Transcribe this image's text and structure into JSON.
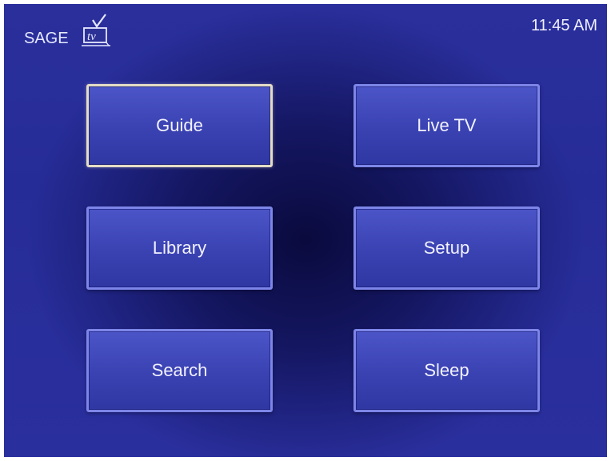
{
  "header": {
    "logo": {
      "text": "SAGE",
      "mark": "tv",
      "icon": "sagetv-tv-checkmark-logo"
    },
    "clock": "11:45 AM"
  },
  "menu": {
    "focused_item": "Guide",
    "items": [
      {
        "label": "Guide"
      },
      {
        "label": "Live TV"
      },
      {
        "label": "Library"
      },
      {
        "label": "Setup"
      },
      {
        "label": "Search"
      },
      {
        "label": "Sleep"
      }
    ]
  },
  "colors": {
    "background": "#262c97",
    "button_fill": "#3a42b2",
    "button_border": "#7d86e8",
    "focus_border": "#e4ddc6",
    "text": "#f2f2ff"
  }
}
